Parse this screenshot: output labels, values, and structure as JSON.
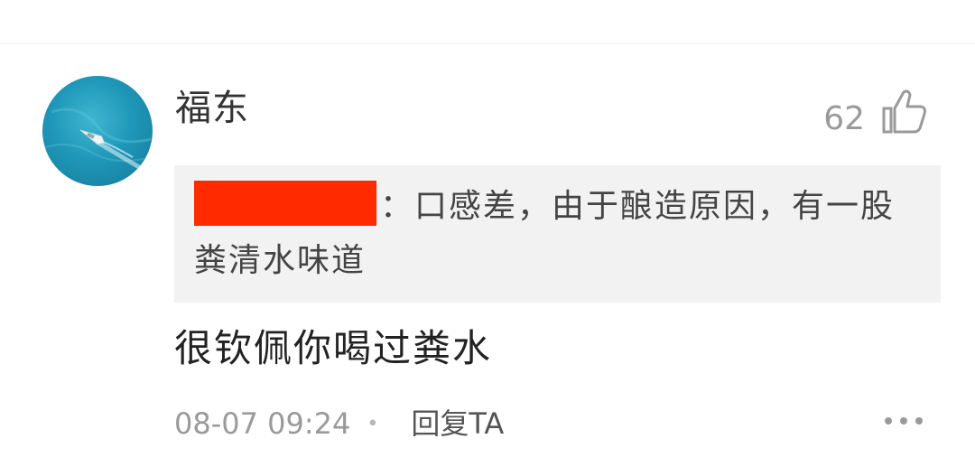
{
  "comment": {
    "username": "福东",
    "like_count": "62",
    "quote": {
      "redacted_name_color": "#ff2a00",
      "text": "：口感差，由于酿造原因，有一股粪清水味道"
    },
    "reply_text": "很钦佩你喝过粪水",
    "timestamp": "08-07 09:24",
    "separator": "•",
    "reply_label": "回复TA",
    "icons": {
      "like": "thumbs-up-icon",
      "more": "more-dots-icon",
      "avatar": "boat-avatar"
    },
    "colors": {
      "quote_background": "#f2f2f2",
      "secondary_text": "#9a9a9a"
    }
  }
}
